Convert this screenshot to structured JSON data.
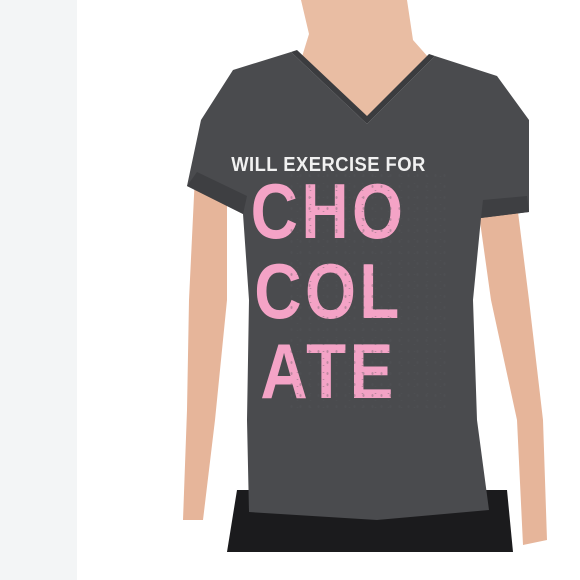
{
  "shirt": {
    "slogan_top": "WILL EXERCISE FOR",
    "slogan_line1": "CHO",
    "slogan_line2": "COL",
    "slogan_line3": "ATE"
  },
  "colors": {
    "shirt": "#4a4b4e",
    "print_pink": "#f4a3c6",
    "print_white": "#f1f1f1",
    "skin": "#e8b89f",
    "pants": "#1b1b1d",
    "side_panel": "#f3f5f6"
  }
}
